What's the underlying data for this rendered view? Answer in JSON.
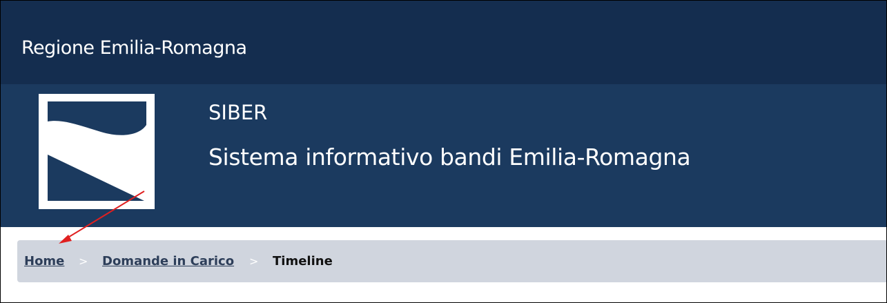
{
  "top_bar": {
    "title": "Regione Emilia-Romagna"
  },
  "header": {
    "logo_icon": "emilia-romagna-logo-icon",
    "app_name": "SIBER",
    "app_subtitle": "Sistema informativo bandi Emilia-Romagna"
  },
  "breadcrumb": {
    "items": [
      {
        "label": "Home",
        "link": true
      },
      {
        "label": "Domande in Carico",
        "link": true
      },
      {
        "label": "Timeline",
        "link": false
      }
    ],
    "separator": ">"
  },
  "annotation": {
    "icon": "red-arrow-icon",
    "color": "#e02020"
  },
  "colors": {
    "top_bar": "#142d4f",
    "header_band": "#1b3a5f",
    "breadcrumb_bg": "#d0d5de",
    "link": "#2d3e59"
  }
}
